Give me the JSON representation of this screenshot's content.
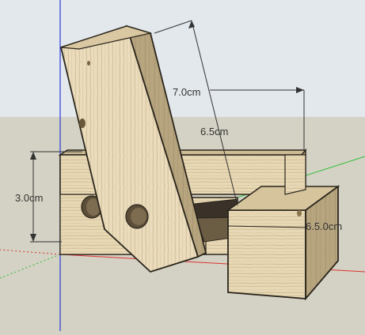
{
  "app": {
    "name": "3D modeling viewport",
    "sky_color": "#e3e8ec",
    "ground_color": "#d4d2c4"
  },
  "dimensions": {
    "length_70": "7.0cm",
    "length_65": "6.5cm",
    "height_30": "3.0cm",
    "overlap_50_60": "6.5.0cm"
  },
  "materials": {
    "wood_light": "#efe4c8",
    "wood_mid": "#d9c8a2",
    "wood_dark": "#9d8a63",
    "edge": "#2b261d"
  },
  "axes": {
    "blue": "#2c3bd6",
    "green": "#2bbd39",
    "red": "#d33"
  }
}
